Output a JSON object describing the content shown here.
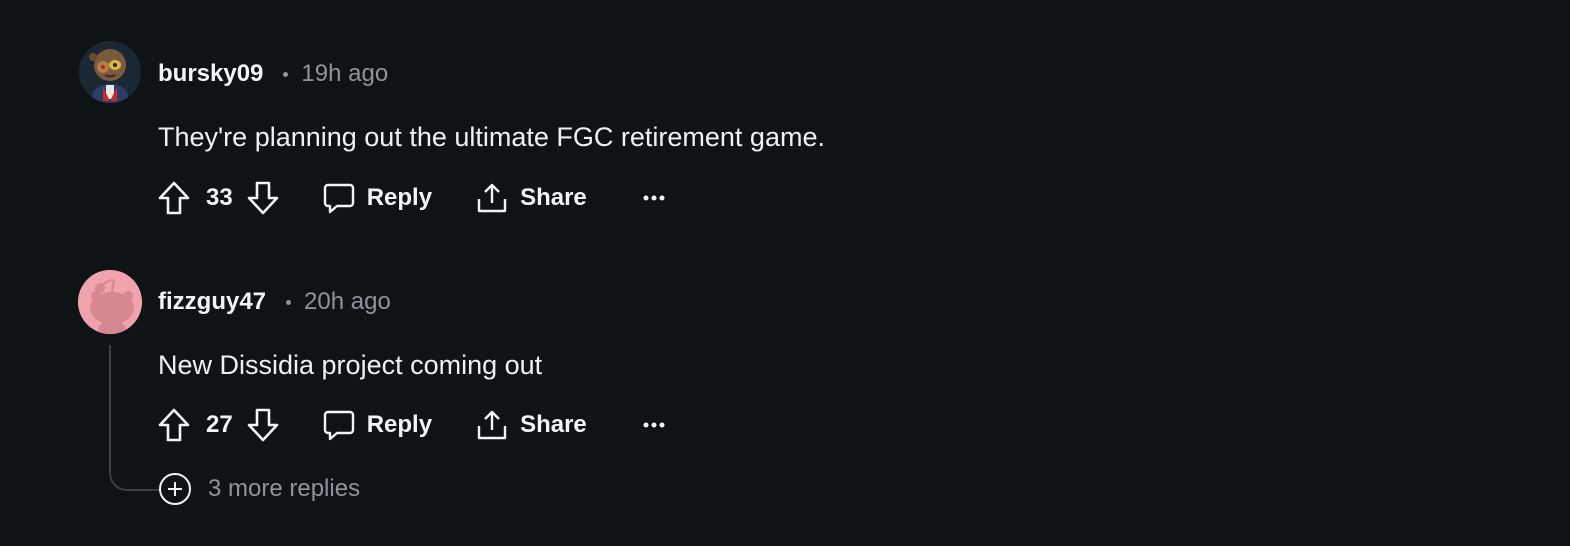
{
  "comments": [
    {
      "username": "bursky09",
      "time": "19h ago",
      "text": "They're planning out the ultimate FGC retirement game.",
      "score": "33",
      "reply_label": "Reply",
      "share_label": "Share",
      "avatar_icon": "avatar-snoo-icon"
    },
    {
      "username": "fizzguy47",
      "time": "20h ago",
      "text": "New Dissidia project coming out",
      "score": "27",
      "reply_label": "Reply",
      "share_label": "Share",
      "avatar_icon": "avatar-default-snoo-icon"
    }
  ],
  "more_replies": {
    "label": "3 more replies",
    "icon": "plus-circle-icon"
  },
  "colors": {
    "background": "#0e1416",
    "text": "#f2f4f5",
    "muted": "#8b959b",
    "default_avatar_bg": "#f0a3ad"
  }
}
